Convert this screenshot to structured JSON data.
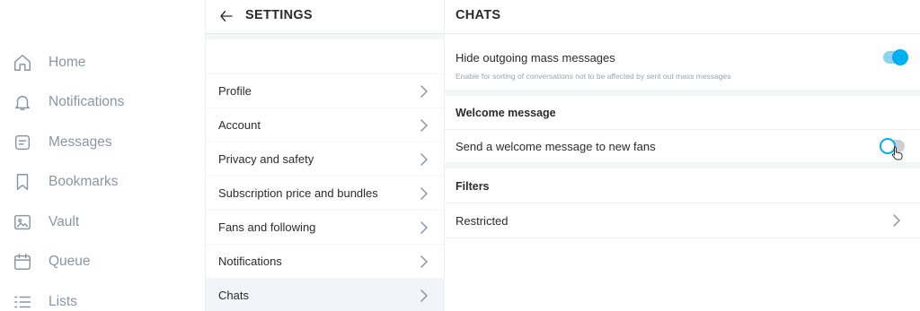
{
  "left_nav": {
    "items": [
      {
        "label": "Home",
        "icon": "home-icon"
      },
      {
        "label": "Notifications",
        "icon": "bell-icon"
      },
      {
        "label": "Messages",
        "icon": "message-icon"
      },
      {
        "label": "Bookmarks",
        "icon": "bookmark-icon"
      },
      {
        "label": "Vault",
        "icon": "vault-icon"
      },
      {
        "label": "Queue",
        "icon": "calendar-icon"
      },
      {
        "label": "Lists",
        "icon": "list-icon"
      }
    ]
  },
  "settings": {
    "title": "SETTINGS",
    "back_icon": "arrow-left-icon",
    "items": [
      {
        "label": "Profile"
      },
      {
        "label": "Account"
      },
      {
        "label": "Privacy and safety"
      },
      {
        "label": "Subscription price and bundles"
      },
      {
        "label": "Fans and following"
      },
      {
        "label": "Notifications"
      },
      {
        "label": "Chats",
        "active": true
      }
    ]
  },
  "chats": {
    "title": "CHATS",
    "hide_mass": {
      "title": "Hide outgoing mass messages",
      "subtitle": "Enable for sorting of conversations not to be affected by sent out mass messages",
      "enabled": true
    },
    "welcome_section": "Welcome message",
    "welcome": {
      "title": "Send a welcome message to new fans",
      "enabled": false
    },
    "filters_section": "Filters",
    "restricted": {
      "label": "Restricted"
    }
  },
  "colors": {
    "accent": "#00aff0",
    "nav_text": "#8a96a3",
    "panel_bg": "#f5f6f7"
  }
}
